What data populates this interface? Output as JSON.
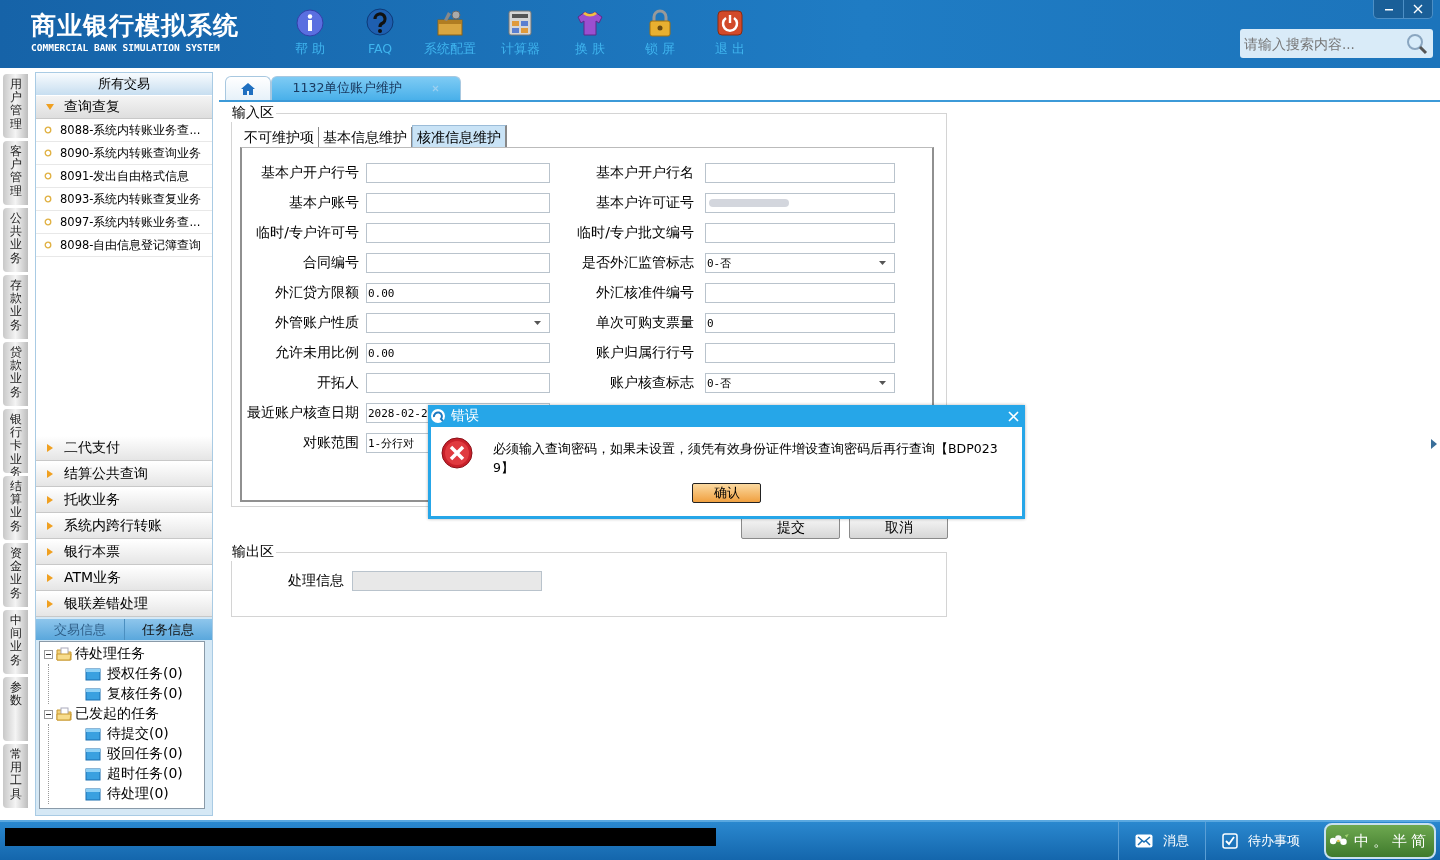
{
  "header": {
    "title": "商业银行模拟系统",
    "subtitle": "COMMERCIAL BANK SIMULATION SYSTEM",
    "toolbar": [
      {
        "label": "帮 助",
        "kind": "info"
      },
      {
        "label": "FAQ",
        "kind": "faq"
      },
      {
        "label": "系统配置",
        "kind": "tools"
      },
      {
        "label": "计算器",
        "kind": "calc"
      },
      {
        "label": "换 肤",
        "kind": "shirt"
      },
      {
        "label": "锁 屏",
        "kind": "lock"
      },
      {
        "label": "退 出",
        "kind": "power"
      }
    ],
    "search": {
      "placeholder": "请输入搜索内容..."
    }
  },
  "module_tabs": [
    {
      "label": "用户管理"
    },
    {
      "label": "客户管理"
    },
    {
      "label": "公共业务"
    },
    {
      "label": "存款业务"
    },
    {
      "label": "贷款业务"
    },
    {
      "label": "银行卡业务"
    },
    {
      "label": "结算业务"
    },
    {
      "label": "资金业务"
    },
    {
      "label": "中间业务"
    },
    {
      "label": "参数"
    },
    {
      "label": "常用工具"
    }
  ],
  "sidebar": {
    "title": "所有交易",
    "groups": [
      {
        "label": "查询查复",
        "expanded": true,
        "items": [
          "8088-系统内转账业务查...",
          "8090-系统内转账查询业务",
          "8091-发出自由格式信息",
          "8093-系统内转账查复业务",
          "8097-系统内转账业务查...",
          "8098-自由信息登记簿查询"
        ]
      },
      {
        "label": "二代支付",
        "expanded": false
      },
      {
        "label": "结算公共查询",
        "expanded": false
      },
      {
        "label": "托收业务",
        "expanded": false
      },
      {
        "label": "系统内跨行转账",
        "expanded": false
      },
      {
        "label": "银行本票",
        "expanded": false
      },
      {
        "label": "ATM业务",
        "expanded": false
      },
      {
        "label": "银联差错处理",
        "expanded": false
      }
    ],
    "info_tabs": [
      {
        "label": "交易信息",
        "selected": false
      },
      {
        "label": "任务信息",
        "selected": true
      }
    ],
    "tree": [
      {
        "label": "待处理任务",
        "expanded": true,
        "children": [
          {
            "label": "授权任务(0)"
          },
          {
            "label": "复核任务(0)"
          }
        ]
      },
      {
        "label": "已发起的任务",
        "expanded": true,
        "children": [
          {
            "label": "待提交(0)"
          },
          {
            "label": "驳回任务(0)"
          },
          {
            "label": "超时任务(0)"
          },
          {
            "label": "待处理(0)"
          }
        ]
      }
    ]
  },
  "tabs": [
    {
      "kind": "home",
      "selected": false
    },
    {
      "kind": "page",
      "label": "1132单位账户维护",
      "selected": true
    }
  ],
  "input_area": {
    "title": "输入区",
    "tabs": [
      {
        "label": "不可维护项",
        "selected": false
      },
      {
        "label": "基本信息维护",
        "selected": false
      },
      {
        "label": "核准信息维护",
        "selected": true
      }
    ],
    "rows": [
      [
        {
          "label": "基本户开户行号",
          "kind": "text"
        },
        {
          "label": "基本户开户行名",
          "kind": "text"
        }
      ],
      [
        {
          "label": "基本户账号",
          "kind": "text"
        },
        {
          "label": "基本户许可证号",
          "kind": "masked"
        }
      ],
      [
        {
          "label": "临时/专户许可号",
          "kind": "text"
        },
        {
          "label": "临时/专户批文编号",
          "kind": "text"
        }
      ],
      [
        {
          "label": "合同编号",
          "kind": "text"
        },
        {
          "label": "是否外汇监管标志",
          "kind": "select",
          "value": "0-否"
        }
      ],
      [
        {
          "label": "外汇贷方限额",
          "kind": "text",
          "value": "0.00"
        },
        {
          "label": "外汇核准件编号",
          "kind": "text"
        }
      ],
      [
        {
          "label": "外管账户性质",
          "kind": "select"
        },
        {
          "label": "单次可购支票量",
          "kind": "text",
          "value": "0"
        }
      ],
      [
        {
          "label": "允许未用比例",
          "kind": "text",
          "value": "0.00"
        },
        {
          "label": "账户归属行行号",
          "kind": "text"
        }
      ],
      [
        {
          "label": "开拓人",
          "kind": "text"
        },
        {
          "label": "账户核查标志",
          "kind": "select",
          "value": "0-否"
        }
      ],
      [
        {
          "label": "最近账户核查日期",
          "kind": "text",
          "value": "2028-02-2"
        }
      ],
      [
        {
          "label": "对账范围",
          "kind": "text",
          "value": "1-分行对"
        }
      ]
    ]
  },
  "buttons": [
    "提交",
    "取消"
  ],
  "output_area": {
    "title": "输出区",
    "fields": [
      {
        "label": "处理信息",
        "disabled": true
      }
    ]
  },
  "dialog": {
    "title": "错误",
    "message": "必须输入查询密码，如果未设置，须凭有效身份证件增设查询密码后再行查询【BDP0239】",
    "button": "确认"
  },
  "status_bar": {
    "items": [
      {
        "label": "消息",
        "kind": "mail"
      },
      {
        "label": "待办事项",
        "kind": "todo"
      }
    ],
    "ime": [
      "中",
      "。",
      "半",
      "简"
    ]
  }
}
